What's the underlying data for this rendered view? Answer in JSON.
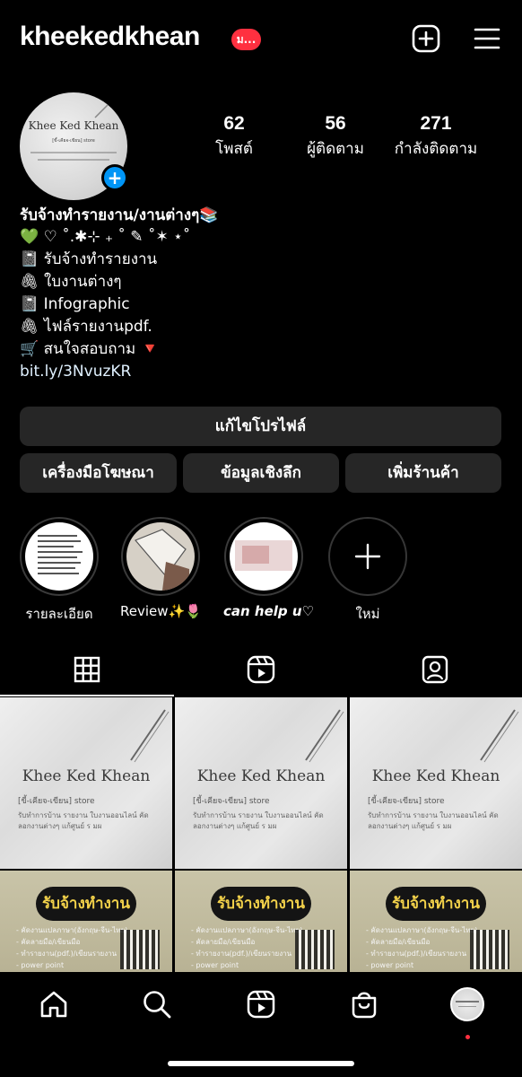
{
  "header": {
    "username": "kheekedkhean",
    "notification_badge": "ม...",
    "create_icon": "plus-square-icon",
    "menu_icon": "hamburger-menu-icon"
  },
  "profile": {
    "avatar_title": "Khee Ked Khean",
    "avatar_subtitle": "[ขี้-เคียจ-เขียน] store",
    "stats": [
      {
        "value": "62",
        "label": "โพสต์"
      },
      {
        "value": "56",
        "label": "ผู้ติดตาม"
      },
      {
        "value": "271",
        "label": "กำลังติดตาม"
      }
    ]
  },
  "bio": {
    "name": "รับจ้างทำรายงาน/งานต่างๆ📚",
    "lines": [
      "💚 ♡ ˚.✱⊹ ₊ ˚ ✎ ˚✶ ⋆˚",
      "📓 รับจ้างทำรายงาน",
      "🖇 ใบงานต่างๆ",
      "📓 Infographic",
      "🖇 ไฟล์รายงานpdf.",
      "🛒 สนใจสอบถาม 🔻"
    ],
    "link": "bit.ly/3NvuzKR"
  },
  "actions": {
    "edit_profile": "แก้ไขโปรไฟล์",
    "ad_tools": "เครื่องมือโฆษณา",
    "insights": "ข้อมูลเชิงลึก",
    "add_shop": "เพิ่มร้านค้า"
  },
  "highlights": [
    {
      "label": "รายละเอียด"
    },
    {
      "label": "Review✨🌷"
    },
    {
      "label": "can help u♡"
    },
    {
      "label": "ใหม่"
    }
  ],
  "tabs": [
    {
      "icon": "grid-icon",
      "active": true
    },
    {
      "icon": "reels-icon",
      "active": false
    },
    {
      "icon": "tagged-icon",
      "active": false
    }
  ],
  "posts": {
    "cover_title": "Khee Ked Khean",
    "cover_subtitle": "[ขี้-เคียจ-เขียน] store",
    "cover_desc": "รับทำการบ้าน รายงาน ใบงานออนไลน์ คัดลอกงานต่างๆ แก้ศูนย์ ร มผ",
    "promo_title": "รับจ้างทำงาน",
    "promo_items": "- คัดงานแปลภาษา(อังกฤษ-จีน-ไทย)\n- คัดลายมือ/เขียนมือ\n- ทำรายงาน(pdf.)/เขียนรายงาน\n- power point"
  },
  "bottom_nav": [
    {
      "icon": "home-icon"
    },
    {
      "icon": "search-icon"
    },
    {
      "icon": "reels-icon"
    },
    {
      "icon": "shop-icon"
    },
    {
      "icon": "profile-avatar"
    }
  ],
  "colors": {
    "background": "#000000",
    "button": "#262626",
    "accent_blue": "#0095f6",
    "badge_red": "#ff3040"
  }
}
